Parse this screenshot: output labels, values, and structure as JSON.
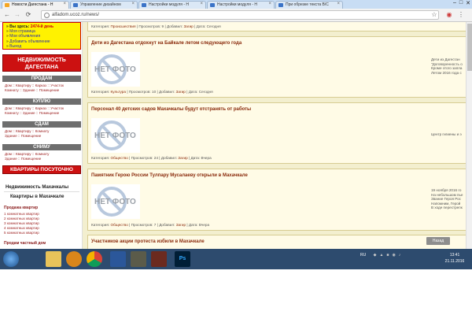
{
  "browser": {
    "tabs": [
      {
        "title": "Новости Дагестана - Н",
        "active": true,
        "color": "#f5a623"
      },
      {
        "title": "Управление дизайном",
        "active": false,
        "color": "#3b73c7"
      },
      {
        "title": "Настройки модуля - Н",
        "active": false,
        "color": "#3b73c7"
      },
      {
        "title": "Настройки модуля - Н",
        "active": false,
        "color": "#3b73c7"
      },
      {
        "title": "При обрезке текста В/С",
        "active": false,
        "color": "#3b73c7"
      }
    ],
    "url": "alfadom.ucoz.ru/news/",
    "window_controls": {
      "minimize": "–",
      "maximize": "□",
      "close": "✕"
    },
    "nav": {
      "back": "←",
      "forward": "→",
      "reload": "⟳",
      "star": "☆",
      "menu": "⋮"
    }
  },
  "sidebar": {
    "user_box": {
      "lines": [
        {
          "prefix": "» Вы здесь: ",
          "value": "2474-й день"
        },
        {
          "prefix": "» ",
          "link": "Моя страница"
        },
        {
          "prefix": "» ",
          "link": "Мои объявления"
        },
        {
          "prefix": "» ",
          "link": "Добавить объявление"
        },
        {
          "prefix": "» ",
          "link": "Выход"
        }
      ]
    },
    "realty_header": [
      "НЕДВИЖИМОСТЬ",
      "ДАГЕСТАНА"
    ],
    "sections": [
      {
        "title": "ПРОДАМ",
        "lines": [
          "Дом :: Квартиру :: Карказ :: Участок",
          "Комнату :: Здание :: Помещение"
        ]
      },
      {
        "title": "КУПЛЮ",
        "lines": [
          "Дом :: Квартиру :: Карказ :: Участок",
          "Комнату :: Здание :: Помещение"
        ]
      },
      {
        "title": "СДАМ",
        "lines": [
          "Дом :: Квартиру :: Комнату",
          "Здание :: Помещение"
        ]
      },
      {
        "title": "СНИМУ",
        "lines": [
          "Дом :: Квартиру :: Комнату",
          "Здание :: Помещение"
        ]
      }
    ],
    "daily_button": "КВАРТИРЫ ПОСУТОЧНО",
    "makh_title": "Недвижимость Махачкалы",
    "apartments_title": "Квартиры в Махачкале",
    "sale_title": "Продажа квартир",
    "sale_items": [
      "1 комнатных квартир",
      "2 комнатных квартир",
      "3 комнатных квартир",
      "4 комнатных квартир",
      "5 комнатных квартир"
    ],
    "houses_title": "Продам частный дом"
  },
  "news": {
    "top_meta": {
      "category_label": "Категория:",
      "category": "Происшествия",
      "views_label": "Просмотров:",
      "views": "9",
      "added_label": "Добавил:",
      "author": "Загир",
      "date_label": "Дата:",
      "date": "Сегодня"
    },
    "cards": [
      {
        "title": "Дети из Дагестана отдохнут на Байкале летом следующего года",
        "image_text": "НЕТ ФОТО",
        "category": "Культура",
        "views": "10",
        "author": "Загир",
        "date": "Сегодня",
        "side_text": "Дети из Дагестан\n\"Договоренность о\nКроме этого запла\nЛетом 2016 года с"
      },
      {
        "title": "Персонал 40 детских садов Махачкалы будут отстранять от работы",
        "image_text": "НЕТ ФОТО",
        "category": "Общество",
        "views": "24",
        "author": "Загир",
        "date": "Вчера",
        "side_text": "Центр гигиены и э"
      },
      {
        "title": "Памятник Герою России Тулпару Мусалаеву открыли в Махачкале",
        "image_text": "НЕТ ФОТО",
        "category": "Общество",
        "views": "7",
        "author": "Загир",
        "date": "Вчера",
        "side_text": "19 ноября 2016 го\nНа небольшом пье\nЗвание Героя Рос\nНапомним, Герой\nВ ходе перестрелк"
      },
      {
        "title": "Участников акции протеста избили в Махачкале"
      }
    ],
    "meta_labels": {
      "category": "Категория:",
      "views": "Просмотров:",
      "added": "Добавил:",
      "date": "Дата:"
    }
  },
  "toast_button": "Назад",
  "taskbar": {
    "apps": [
      "start",
      "explorer",
      "media",
      "chrome",
      "word",
      "tanks",
      "wot",
      "photoshop"
    ],
    "ps_label": "Ps",
    "tray_lang": "RU",
    "time": "13:41",
    "date": "21.11.2016"
  }
}
